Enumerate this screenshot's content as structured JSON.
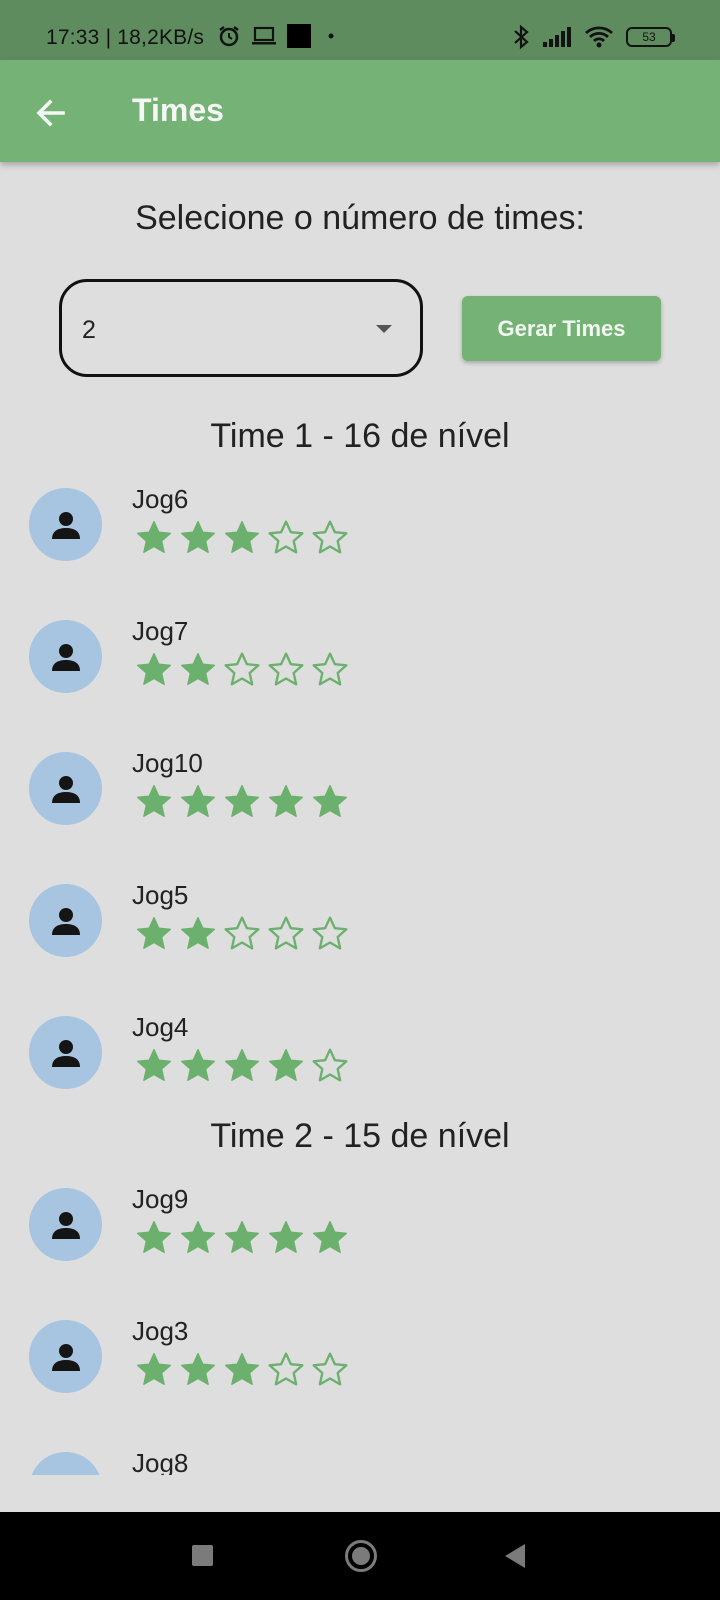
{
  "status_bar": {
    "time": "17:33 | 18,2KB/s",
    "battery": "53",
    "icons_left": [
      "alarm-icon",
      "laptop-icon",
      "black-square-icon",
      "dot-icon"
    ],
    "icons_right": [
      "bluetooth-icon",
      "signal-icon",
      "wifi-icon",
      "battery-icon"
    ]
  },
  "app_bar": {
    "title": "Times",
    "back_icon": "arrow-left-icon",
    "color": "#74b276"
  },
  "prompt": "Selecione o número de times:",
  "team_count_select": {
    "value": "2"
  },
  "generate_button": {
    "label": "Gerar Times"
  },
  "teams": [
    {
      "heading": "Time 1 - 16 de nível",
      "players": [
        {
          "name": "Jog6",
          "rating": 3
        },
        {
          "name": "Jog7",
          "rating": 2
        },
        {
          "name": "Jog10",
          "rating": 5
        },
        {
          "name": "Jog5",
          "rating": 2
        },
        {
          "name": "Jog4",
          "rating": 4
        }
      ]
    },
    {
      "heading": "Time 2 - 15 de nível",
      "players": [
        {
          "name": "Jog9",
          "rating": 5
        },
        {
          "name": "Jog3",
          "rating": 3
        },
        {
          "name": "Jog8",
          "rating": null
        }
      ]
    }
  ],
  "colors": {
    "star": "#6cb06e",
    "avatar": "#a7c4e0",
    "background": "#dedede"
  }
}
